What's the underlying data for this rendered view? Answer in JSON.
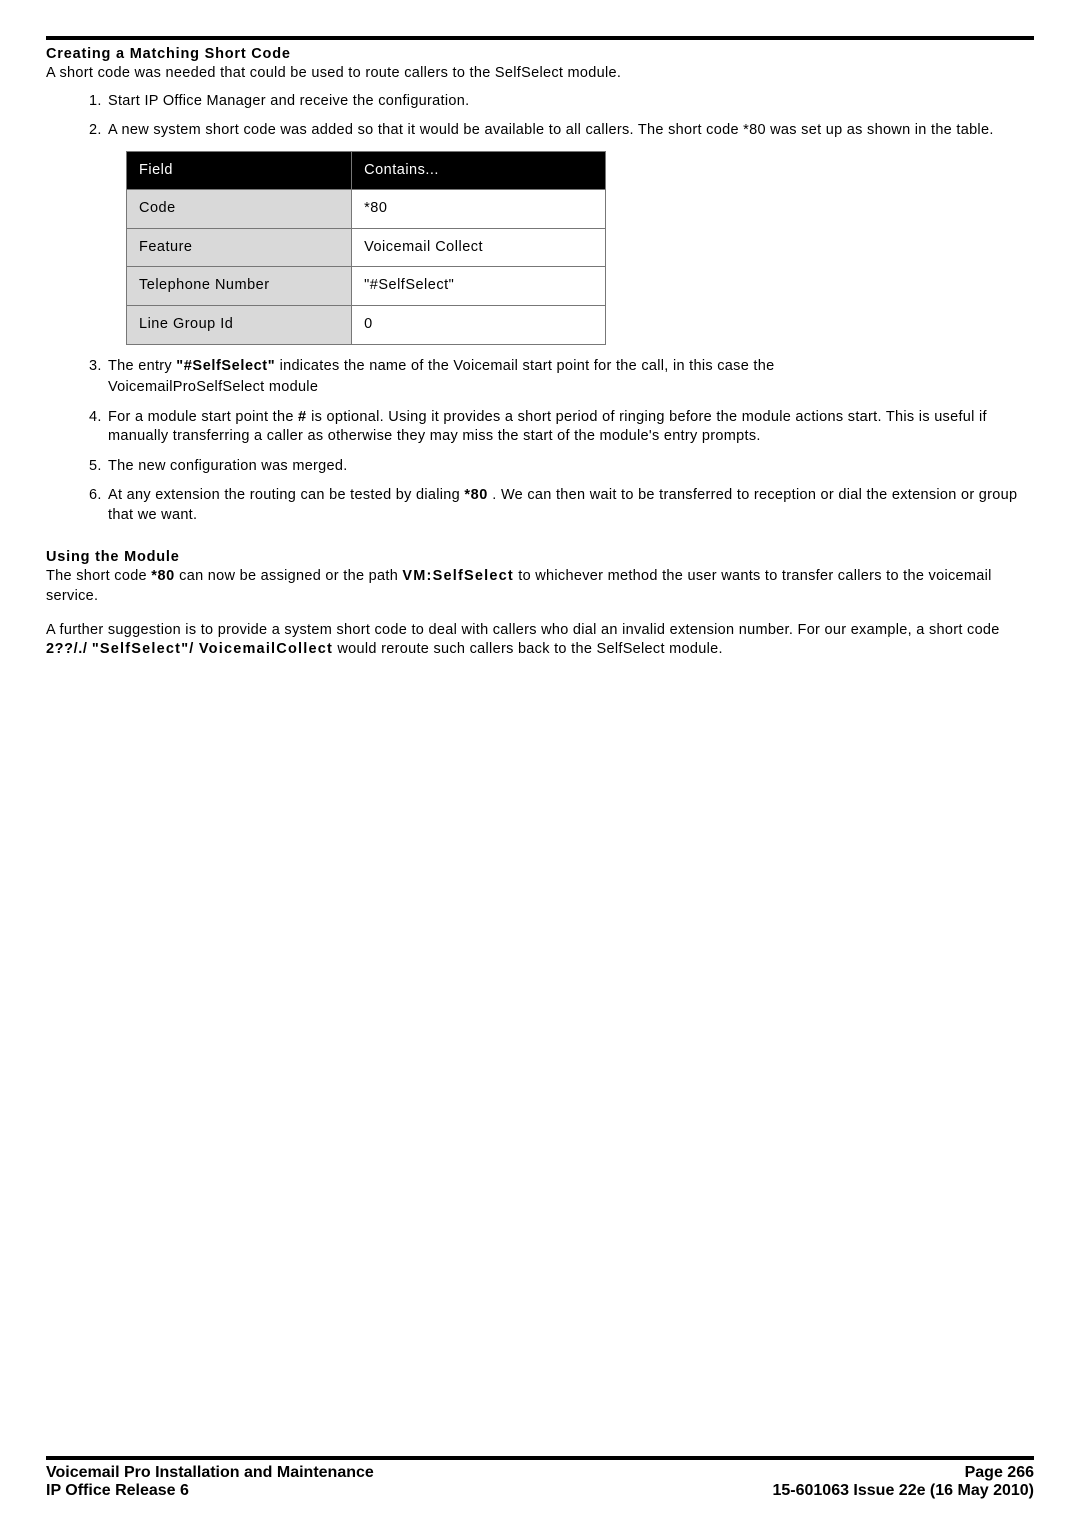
{
  "section1": {
    "heading": "Creating a Matching Short Code",
    "intro": "A short code was needed that could be used to route callers to the SelfSelect module.",
    "steps": [
      "Start IP Office Manager and receive the configuration.",
      "A new system short code was added so that it would be available to all callers. The short code *80 was set up as shown in the table."
    ],
    "table": {
      "headers": [
        "Field",
        "Contains..."
      ],
      "rows": [
        [
          "Code",
          "*80"
        ],
        [
          "Feature",
          "Voicemail Collect"
        ],
        [
          "Telephone Number",
          "\"#SelfSelect\""
        ],
        [
          "Line Group Id",
          "0"
        ]
      ]
    },
    "step3": {
      "a": "The entry ",
      "b": "\"#SelfSelect\"",
      "c": " indicates the name of the Voicemail start point for the call, in this case the",
      "d": "VoicemailProSelfSelect module"
    },
    "step4": {
      "a": "For a module start point the ",
      "b": "#",
      "c": " is optional. Using it provides a short period of ringing before the module actions start. This is useful if manually transferring a caller as otherwise they may miss the start of the module's entry prompts."
    },
    "step5": "The new configuration was merged.",
    "step6": {
      "a": "At any extension the routing can be tested by dialing ",
      "b": "*80",
      "c": ". We can then wait to be transferred to reception or dial the extension or group that we want."
    }
  },
  "section2": {
    "heading": "Using the Module",
    "p1": {
      "a": "The short code ",
      "b": "*80",
      "c": " can now be assigned or the path ",
      "d": "VM:SelfSelect",
      "e": " to whichever method the user wants to transfer callers to the voicemail service."
    },
    "p2": {
      "a": "A further suggestion is to provide a system short code to deal with callers who dial an invalid extension number. For our example, a short code ",
      "b": "2??/./",
      "c": " ",
      "d": "\"SelfSelect\"/",
      "e": " ",
      "f": "VoicemailCollect",
      "g": " would reroute such callers back to the SelfSelect module."
    }
  },
  "footer": {
    "left1": "Voicemail Pro Installation and Maintenance",
    "right1": "Page 266",
    "left2": "IP Office Release 6",
    "right2": "15-601063 Issue 22e (16 May 2010)"
  }
}
